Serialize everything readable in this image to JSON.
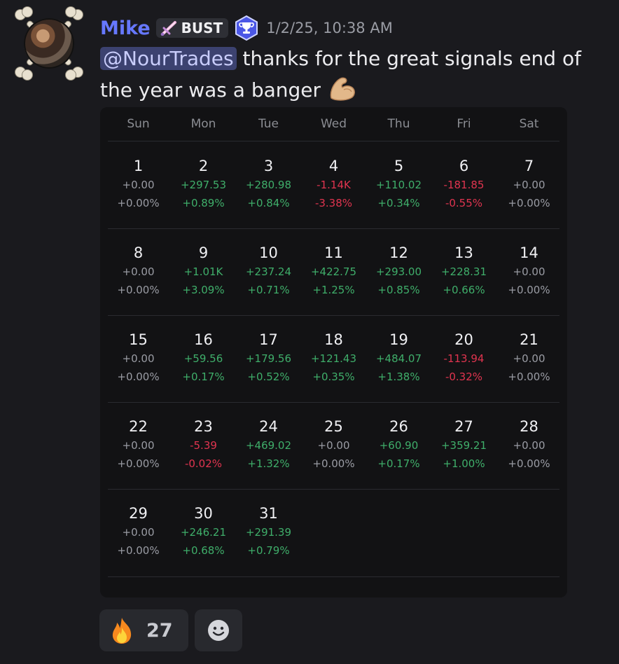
{
  "message": {
    "author": "Mike",
    "role_tag": "BUST",
    "timestamp": "1/2/25, 10:38 AM",
    "mention": "@NourTrades",
    "text_line1": " thanks for the great signals end of",
    "text_line2": "the year was a banger",
    "author_color": "#6678ff"
  },
  "calendar": {
    "weekdays": [
      "Sun",
      "Mon",
      "Tue",
      "Wed",
      "Thu",
      "Fri",
      "Sat"
    ],
    "weeks": [
      [
        {
          "day": "1",
          "amount": "+0.00",
          "percent": "+0.00%",
          "status": "zero"
        },
        {
          "day": "2",
          "amount": "+297.53",
          "percent": "+0.89%",
          "status": "pos"
        },
        {
          "day": "3",
          "amount": "+280.98",
          "percent": "+0.84%",
          "status": "pos"
        },
        {
          "day": "4",
          "amount": "-1.14K",
          "percent": "-3.38%",
          "status": "neg"
        },
        {
          "day": "5",
          "amount": "+110.02",
          "percent": "+0.34%",
          "status": "pos"
        },
        {
          "day": "6",
          "amount": "-181.85",
          "percent": "-0.55%",
          "status": "neg"
        },
        {
          "day": "7",
          "amount": "+0.00",
          "percent": "+0.00%",
          "status": "zero"
        }
      ],
      [
        {
          "day": "8",
          "amount": "+0.00",
          "percent": "+0.00%",
          "status": "zero"
        },
        {
          "day": "9",
          "amount": "+1.01K",
          "percent": "+3.09%",
          "status": "pos"
        },
        {
          "day": "10",
          "amount": "+237.24",
          "percent": "+0.71%",
          "status": "pos"
        },
        {
          "day": "11",
          "amount": "+422.75",
          "percent": "+1.25%",
          "status": "pos"
        },
        {
          "day": "12",
          "amount": "+293.00",
          "percent": "+0.85%",
          "status": "pos"
        },
        {
          "day": "13",
          "amount": "+228.31",
          "percent": "+0.66%",
          "status": "pos"
        },
        {
          "day": "14",
          "amount": "+0.00",
          "percent": "+0.00%",
          "status": "zero"
        }
      ],
      [
        {
          "day": "15",
          "amount": "+0.00",
          "percent": "+0.00%",
          "status": "zero"
        },
        {
          "day": "16",
          "amount": "+59.56",
          "percent": "+0.17%",
          "status": "pos"
        },
        {
          "day": "17",
          "amount": "+179.56",
          "percent": "+0.52%",
          "status": "pos"
        },
        {
          "day": "18",
          "amount": "+121.43",
          "percent": "+0.35%",
          "status": "pos"
        },
        {
          "day": "19",
          "amount": "+484.07",
          "percent": "+1.38%",
          "status": "pos"
        },
        {
          "day": "20",
          "amount": "-113.94",
          "percent": "-0.32%",
          "status": "neg"
        },
        {
          "day": "21",
          "amount": "+0.00",
          "percent": "+0.00%",
          "status": "zero"
        }
      ],
      [
        {
          "day": "22",
          "amount": "+0.00",
          "percent": "+0.00%",
          "status": "zero"
        },
        {
          "day": "23",
          "amount": "-5.39",
          "percent": "-0.02%",
          "status": "neg"
        },
        {
          "day": "24",
          "amount": "+469.02",
          "percent": "+1.32%",
          "status": "pos"
        },
        {
          "day": "25",
          "amount": "+0.00",
          "percent": "+0.00%",
          "status": "zero"
        },
        {
          "day": "26",
          "amount": "+60.90",
          "percent": "+0.17%",
          "status": "pos"
        },
        {
          "day": "27",
          "amount": "+359.21",
          "percent": "+1.00%",
          "status": "pos"
        },
        {
          "day": "28",
          "amount": "+0.00",
          "percent": "+0.00%",
          "status": "zero"
        }
      ],
      [
        {
          "day": "29",
          "amount": "+0.00",
          "percent": "+0.00%",
          "status": "zero"
        },
        {
          "day": "30",
          "amount": "+246.21",
          "percent": "+0.68%",
          "status": "pos"
        },
        {
          "day": "31",
          "amount": "+291.39",
          "percent": "+0.79%",
          "status": "pos"
        }
      ]
    ],
    "colors": {
      "positive": "#3fae6a",
      "negative": "#e0344f",
      "neutral": "#9a9ca4"
    }
  },
  "reactions": [
    {
      "icon": "fire-icon",
      "count": "27"
    },
    {
      "icon": "add-reaction-icon",
      "count": ""
    }
  ]
}
